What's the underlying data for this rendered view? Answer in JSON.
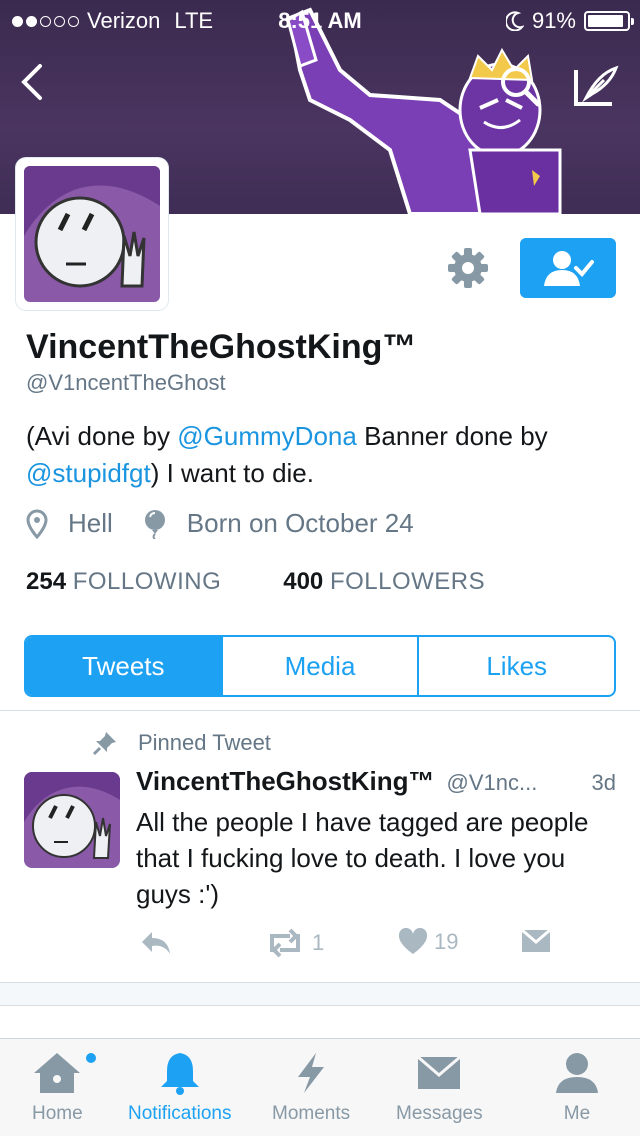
{
  "status_bar": {
    "carrier": "Verizon",
    "network": "LTE",
    "time": "8:51 AM",
    "battery": "91%",
    "battery_level": 0.91,
    "signal_bars_filled": 2,
    "signal_bars_total": 5
  },
  "profile": {
    "display_name": "VincentTheGhostKing™",
    "handle": "@V1ncentTheGhost",
    "bio_part1": "(Avi done by ",
    "bio_mention1": "@GummyDona",
    "bio_part2": " Banner done by ",
    "bio_mention2": "@stupidfgt",
    "bio_part3": ") I want to die.",
    "location": "Hell",
    "birthday": "Born on October 24",
    "following_count": "254",
    "following_label": "FOLLOWING",
    "followers_count": "400",
    "followers_label": "FOLLOWERS"
  },
  "tabs": [
    {
      "label": "Tweets",
      "active": true
    },
    {
      "label": "Media",
      "active": false
    },
    {
      "label": "Likes",
      "active": false
    }
  ],
  "pinned_label": "Pinned Tweet",
  "tweet": {
    "name": "VincentTheGhostKing™",
    "handle": "@V1nc...",
    "time": "3d",
    "text": "All the people I have tagged are people that I fucking love to death. I love you guys :')",
    "retweets": "1",
    "likes": "19"
  },
  "tab_bar": [
    {
      "label": "Home",
      "icon": "home-icon"
    },
    {
      "label": "Notifications",
      "icon": "bell-icon",
      "active": true
    },
    {
      "label": "Moments",
      "icon": "lightning-icon"
    },
    {
      "label": "Messages",
      "icon": "envelope-icon"
    },
    {
      "label": "Me",
      "icon": "person-icon"
    }
  ],
  "colors": {
    "accent": "#1da1f2",
    "banner": "#3b2a4f",
    "muted": "#657786"
  }
}
